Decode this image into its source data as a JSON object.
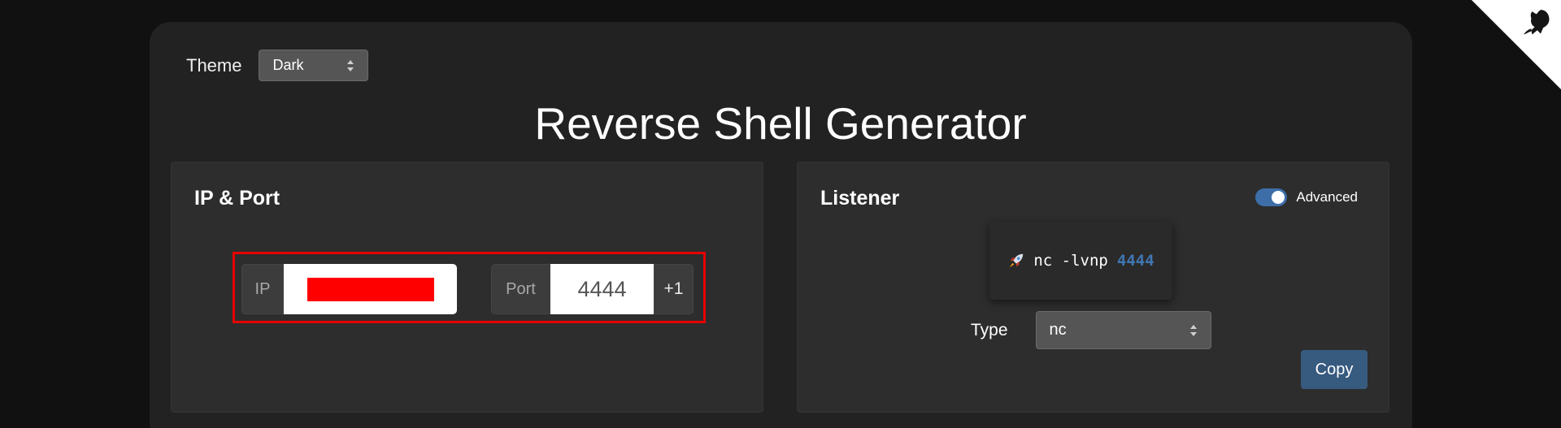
{
  "theme": {
    "label": "Theme",
    "selected": "Dark"
  },
  "page_title": "Reverse Shell Generator",
  "ip_port_panel": {
    "title": "IP & Port",
    "ip_addon": "IP",
    "ip_value": "",
    "port_addon": "Port",
    "port_value": "4444",
    "port_increment": "+1"
  },
  "listener_panel": {
    "title": "Listener",
    "advanced_label": "Advanced",
    "advanced_enabled": true,
    "command_text": "nc -lvnp",
    "command_port": "4444",
    "command_icon": "rocket-icon",
    "type_label": "Type",
    "type_selected": "nc",
    "copy_label": "Copy"
  },
  "colors": {
    "accent": "#375a7f",
    "highlight_border": "#e60000",
    "redaction": "#ff0000",
    "port_highlight": "#3f76b0"
  }
}
